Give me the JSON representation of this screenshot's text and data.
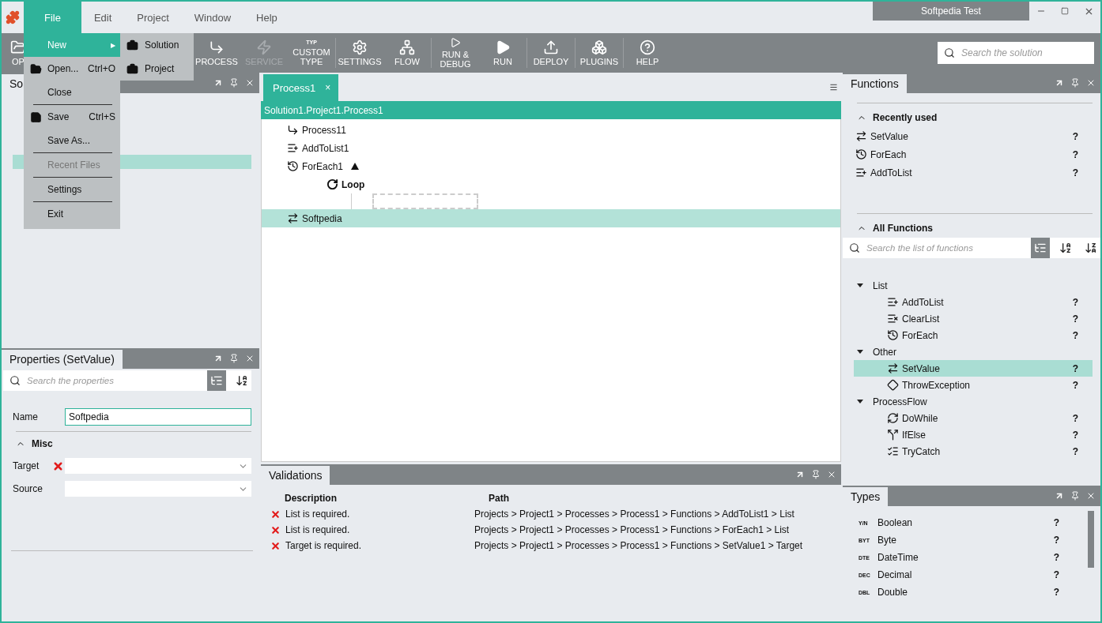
{
  "app": {
    "title": "Softpedia Test"
  },
  "menu_bar": [
    {
      "label": "File",
      "selected": true
    },
    {
      "label": "Edit",
      "selected": false
    },
    {
      "label": "Project",
      "selected": false
    },
    {
      "label": "Window",
      "selected": false
    },
    {
      "label": "Help",
      "selected": false
    }
  ],
  "file_menu": [
    {
      "kind": "item",
      "label": "New",
      "highlighted": true,
      "submenu_arrow": "▶",
      "disabled": false
    },
    {
      "kind": "item",
      "label": "Open...",
      "shortcut": "Ctrl+O",
      "highlighted": false,
      "disabled": false
    },
    {
      "kind": "item",
      "label": "Close",
      "highlighted": false,
      "disabled": false
    },
    {
      "kind": "separator"
    },
    {
      "kind": "item",
      "label": "Save",
      "shortcut": "Ctrl+S",
      "highlighted": false,
      "disabled": false
    },
    {
      "kind": "item",
      "label": "Save As...",
      "highlighted": false,
      "disabled": false
    },
    {
      "kind": "separator"
    },
    {
      "kind": "item",
      "label": "Recent Files",
      "highlighted": false,
      "disabled": true
    },
    {
      "kind": "separator"
    },
    {
      "kind": "item",
      "label": "Settings",
      "highlighted": false,
      "disabled": false
    },
    {
      "kind": "separator"
    },
    {
      "kind": "item",
      "label": "Exit",
      "highlighted": false,
      "disabled": false
    }
  ],
  "new_submenu": [
    {
      "label": "Solution"
    },
    {
      "label": "Project"
    }
  ],
  "toolbar": [
    {
      "kind": "button",
      "label": "OP",
      "disabled": false
    },
    {
      "kind": "gap"
    },
    {
      "kind": "button",
      "label": "PROCESS",
      "disabled": false
    },
    {
      "kind": "button",
      "label": "SERVICE",
      "disabled": true
    },
    {
      "kind": "button",
      "label": "CUSTOM TYPE",
      "badge": "TYP",
      "disabled": false
    },
    {
      "kind": "separator"
    },
    {
      "kind": "button",
      "label": "SETTINGS",
      "disabled": false
    },
    {
      "kind": "button",
      "label": "FLOW",
      "disabled": false
    },
    {
      "kind": "separator"
    },
    {
      "kind": "button",
      "label": "RUN & DEBUG",
      "disabled": false
    },
    {
      "kind": "button",
      "label": "RUN",
      "disabled": false
    },
    {
      "kind": "separator"
    },
    {
      "kind": "button",
      "label": "DEPLOY",
      "disabled": false
    },
    {
      "kind": "separator"
    },
    {
      "kind": "button",
      "label": "PLUGINS",
      "disabled": false
    },
    {
      "kind": "separator"
    },
    {
      "kind": "button",
      "label": "HELP",
      "disabled": false
    }
  ],
  "search": {
    "placeholder": "Search the solution"
  },
  "solution_explorer": {
    "title": "So"
  },
  "properties": {
    "title": "Properties (SetValue)",
    "search_placeholder": "Search the properties",
    "sort_buttons": [
      {
        "selected": true
      },
      {
        "selected": false
      }
    ],
    "name_field": {
      "label": "Name",
      "value": "Softpedia",
      "focused": true
    },
    "section": {
      "label": "Misc",
      "expanded": true
    },
    "fields": [
      {
        "label": "Target",
        "error": true
      },
      {
        "label": "Source",
        "error": false
      }
    ]
  },
  "editor": {
    "tab": {
      "label": "Process1",
      "close": "×"
    },
    "breadcrumb": "Solution1.Project1.Process1",
    "nodes": [
      {
        "label": "Process11",
        "selected": false
      },
      {
        "label": "AddToList1",
        "selected": false
      },
      {
        "label": "ForEach1",
        "selected": false,
        "expanded": true,
        "children": [
          {
            "label": "Loop",
            "selected": false
          }
        ]
      },
      {
        "label": "Softpedia",
        "selected": true
      }
    ]
  },
  "validations": {
    "title": "Validations",
    "columns": [
      "Description",
      "Path"
    ],
    "rows": [
      {
        "description": "List is required.",
        "path": "Projects > Project1 > Processes > Process1 > Functions > AddToList1 > List"
      },
      {
        "description": "List is required.",
        "path": "Projects > Project1 > Processes > Process1 > Functions > ForEach1 > List"
      },
      {
        "description": "Target is required.",
        "path": "Projects > Project1 > Processes > Process1 > Functions > SetValue1 > Target"
      }
    ]
  },
  "functions": {
    "title": "Functions",
    "recent": {
      "label": "Recently used",
      "expanded": true,
      "items": [
        {
          "label": "SetValue",
          "help": "?"
        },
        {
          "label": "ForEach",
          "help": "?"
        },
        {
          "label": "AddToList",
          "help": "?"
        }
      ]
    },
    "all": {
      "label": "All Functions",
      "expanded": true,
      "search_placeholder": "Search the list of functions",
      "sort_buttons": [
        {
          "selected": true
        },
        {
          "selected": false
        },
        {
          "selected": false
        }
      ],
      "groups": [
        {
          "label": "List",
          "expanded": true,
          "children": [
            {
              "label": "AddToList",
              "help": "?",
              "selected": false
            },
            {
              "label": "ClearList",
              "help": "?",
              "selected": false
            },
            {
              "label": "ForEach",
              "help": "?",
              "selected": false
            }
          ]
        },
        {
          "label": "Other",
          "expanded": true,
          "children": [
            {
              "label": "SetValue",
              "help": "?",
              "selected": true
            },
            {
              "label": "ThrowException",
              "help": "?",
              "selected": false
            }
          ]
        },
        {
          "label": "ProcessFlow",
          "expanded": true,
          "children": [
            {
              "label": "DoWhile",
              "help": "?",
              "selected": false
            },
            {
              "label": "IfElse",
              "help": "?",
              "selected": false
            },
            {
              "label": "TryCatch",
              "help": "?",
              "selected": false
            }
          ]
        }
      ]
    }
  },
  "types": {
    "title": "Types",
    "items": [
      {
        "code": "Y/N",
        "label": "Boolean",
        "help": "?"
      },
      {
        "code": "BYT",
        "label": "Byte",
        "help": "?"
      },
      {
        "code": "DTE",
        "label": "DateTime",
        "help": "?"
      },
      {
        "code": "DEC",
        "label": "Decimal",
        "help": "?"
      },
      {
        "code": "DBL",
        "label": "Double",
        "help": "?"
      }
    ]
  }
}
